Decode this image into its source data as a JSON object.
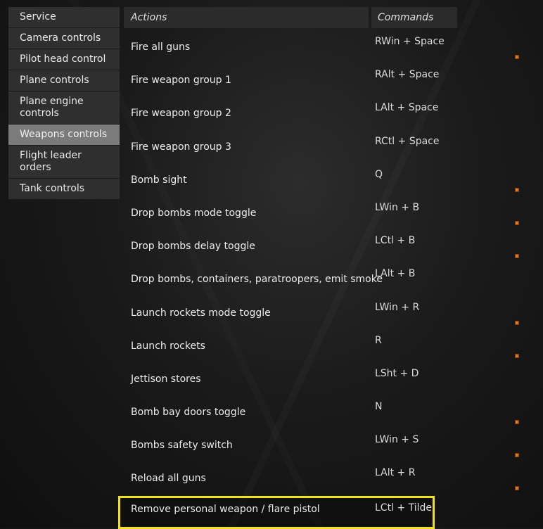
{
  "sidebar": {
    "items": [
      {
        "label": "Service",
        "active": false
      },
      {
        "label": "Camera controls",
        "active": false
      },
      {
        "label": "Pilot head control",
        "active": false
      },
      {
        "label": "Plane controls",
        "active": false
      },
      {
        "label": "Plane engine controls",
        "active": false
      },
      {
        "label": "Weapons controls",
        "active": true
      },
      {
        "label": "Flight leader orders",
        "active": false
      },
      {
        "label": "Tank controls",
        "active": false
      }
    ]
  },
  "table": {
    "headers": {
      "actions": "Actions",
      "commands": "Commands"
    },
    "rows": [
      {
        "action": "Fire all guns",
        "command": "RWin + Space",
        "marked": true
      },
      {
        "action": "Fire weapon group 1",
        "command": "RAlt + Space",
        "marked": false
      },
      {
        "action": "Fire weapon group 2",
        "command": "LAlt + Space",
        "marked": false
      },
      {
        "action": "Fire weapon group 3",
        "command": "RCtl + Space",
        "marked": false
      },
      {
        "action": "Bomb sight",
        "command": "Q",
        "marked": true
      },
      {
        "action": "Drop bombs mode toggle",
        "command": "LWin + B",
        "marked": true
      },
      {
        "action": "Drop bombs delay toggle",
        "command": "LCtl + B",
        "marked": true
      },
      {
        "action": "Drop bombs, containers, paratroopers, emit smoke",
        "command": "LAlt + B",
        "marked": false
      },
      {
        "action": "Launch rockets mode toggle",
        "command": "LWin + R",
        "marked": true
      },
      {
        "action": "Launch rockets",
        "command": "R",
        "marked": true
      },
      {
        "action": "Jettison stores",
        "command": "LSht + D",
        "marked": false
      },
      {
        "action": "Bomb bay doors toggle",
        "command": "N",
        "marked": true
      },
      {
        "action": "Bombs safety switch",
        "command": "LWin + S",
        "marked": true
      },
      {
        "action": "Reload all guns",
        "command": "LAlt + R",
        "marked": true
      },
      {
        "action": "Remove personal weapon / flare pistol",
        "command": "LCtl + Tilde",
        "marked": false,
        "selected": true
      }
    ]
  },
  "colors": {
    "selection_outline": "#f0e21c",
    "marker": "#e07820",
    "active_menu_bg": "#7b7b7b"
  }
}
